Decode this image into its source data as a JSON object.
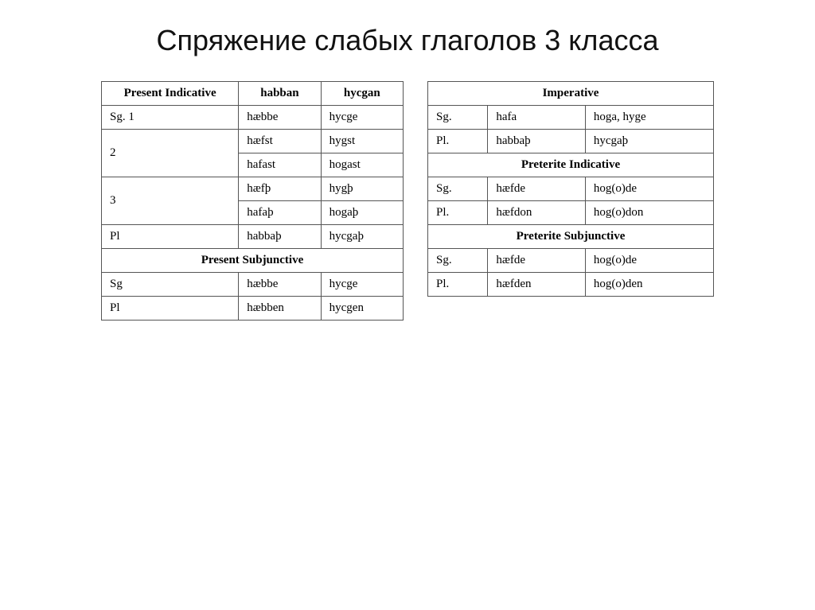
{
  "title": "Спряжение слабых глаголов 3 класса",
  "left_table": {
    "header": {
      "label": "Present Indicative",
      "col1": "habban",
      "col2": "hycgan"
    },
    "rows": [
      {
        "label": "Sg. 1",
        "col1": "hæbbe",
        "col2": "hycge"
      },
      {
        "label": "2",
        "col1": "hæfst\n\nhafast",
        "col2": "hygst\n\nhogast"
      },
      {
        "label": "3",
        "col1": "hæfþ\n\nhafaþ",
        "col2": "hygþ\n\nhogaþ"
      },
      {
        "label": "Pl",
        "col1": "habbaþ",
        "col2": "hycgaþ"
      }
    ],
    "subheader": "Present Subjunctive",
    "sub_rows": [
      {
        "label": "Sg",
        "col1": "hæbbe",
        "col2": "hycge"
      },
      {
        "label": "Pl",
        "col1": "hæbben",
        "col2": "hycgen"
      }
    ]
  },
  "right_table": {
    "sections": [
      {
        "header": "Imperative",
        "rows": [
          {
            "label": "Sg.",
            "col1": "hafa",
            "col2": "hoga, hyge"
          },
          {
            "label": "Pl.",
            "col1": "habbaþ",
            "col2": "hycgaþ"
          }
        ]
      },
      {
        "header": "Preterite Indicative",
        "rows": [
          {
            "label": "Sg.",
            "col1": "hæfde",
            "col2": "hog(o)de"
          },
          {
            "label": "Pl.",
            "col1": "hæfdon",
            "col2": "hog(o)don"
          }
        ]
      },
      {
        "header": "Preterite Subjunctive",
        "rows": [
          {
            "label": "Sg.",
            "col1": "hæfde",
            "col2": "hog(o)de"
          },
          {
            "label": "Pl.",
            "col1": "hæfden",
            "col2": "hog(o)den"
          }
        ]
      }
    ]
  }
}
